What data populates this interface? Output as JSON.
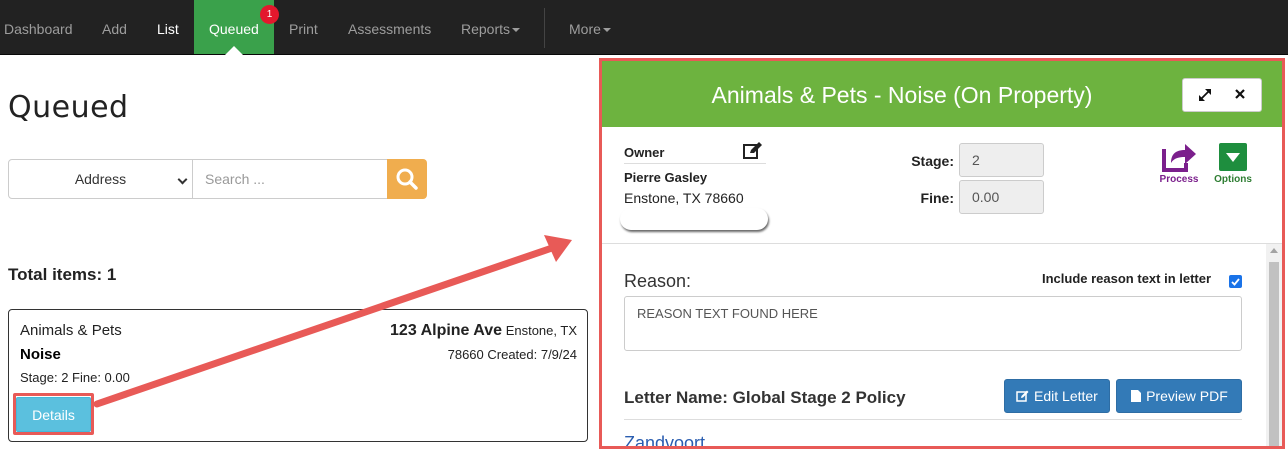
{
  "nav": {
    "items": [
      {
        "label": "Dashboard"
      },
      {
        "label": "Add"
      },
      {
        "label": "List"
      },
      {
        "label": "Queued",
        "badge": "1"
      },
      {
        "label": "Print"
      },
      {
        "label": "Assessments"
      },
      {
        "label": "Reports"
      },
      {
        "label": "More"
      }
    ]
  },
  "page": {
    "title": "Queued",
    "search": {
      "select_value": "Address",
      "placeholder": "Search ..."
    },
    "total_items": "Total items: 1"
  },
  "card": {
    "category": "Animals & Pets",
    "subcategory": "Noise",
    "stage_fine": "Stage: 2 Fine: 0.00",
    "street": "123 Alpine Ave",
    "city": "Enstone, TX",
    "zip_created": "78660 Created: 7/9/24",
    "details_label": "Details"
  },
  "modal": {
    "title": "Animals & Pets - Noise (On Property)",
    "owner_label": "Owner",
    "owner_name": "Pierre Gasley",
    "owner_city": "Enstone, TX 78660",
    "stage_label": "Stage:",
    "stage_value": "2",
    "fine_label": "Fine:",
    "fine_value": "0.00",
    "process_label": "Process",
    "options_label": "Options",
    "reason_label": "Reason:",
    "include_label": "Include reason text in letter",
    "reason_text": "REASON TEXT FOUND HERE",
    "letter_name": "Letter Name: Global Stage 2 Policy",
    "edit_letter_label": "Edit Letter",
    "preview_pdf_label": "Preview PDF",
    "link_text": "Zandvoort"
  },
  "colors": {
    "navbar": "#222222",
    "active_tab": "#3aa14b",
    "modal_header": "#6db33f",
    "annotation": "#e85a57",
    "primary": "#337ab7",
    "info": "#5bc0de",
    "warning": "#f0ad4e"
  }
}
